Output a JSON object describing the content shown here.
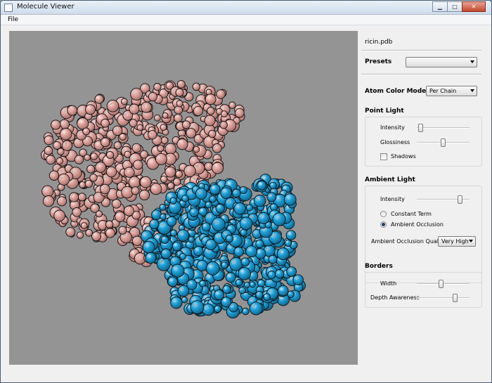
{
  "window": {
    "title": "Molecule Viewer",
    "controls": {
      "minimize": "▁",
      "maximize": "□",
      "close": "✕"
    }
  },
  "menu": {
    "file": "File"
  },
  "viewport": {
    "background": "#949494",
    "chain_colors": [
      "#e6a7a0",
      "#1fa6e0"
    ]
  },
  "panel": {
    "file_name": "ricin.pdb",
    "presets": {
      "label": "Presets",
      "value": ""
    },
    "atom_color_mode": {
      "label": "Atom Color Mode",
      "value": "Per Chain"
    },
    "point_light": {
      "title": "Point Light",
      "intensity": {
        "label": "Intensity",
        "value": 0.03
      },
      "glossiness": {
        "label": "Glossiness",
        "value": 0.5
      },
      "shadows": {
        "label": "Shadows",
        "checked": false
      }
    },
    "ambient_light": {
      "title": "Ambient Light",
      "intensity": {
        "label": "Intensity",
        "value": 0.85
      },
      "constant_term": {
        "label": "Constant Term",
        "selected": false
      },
      "ambient_occlusion": {
        "label": "Ambient Occlusion",
        "selected": true
      },
      "quality": {
        "label": "Ambient Occlusion Quality",
        "value": "Very High"
      }
    },
    "borders": {
      "title": "Borders",
      "width": {
        "label": "Width",
        "value": 0.45
      },
      "depth_awareness": {
        "label": "Depth Awareness",
        "value": 0.75
      }
    }
  }
}
